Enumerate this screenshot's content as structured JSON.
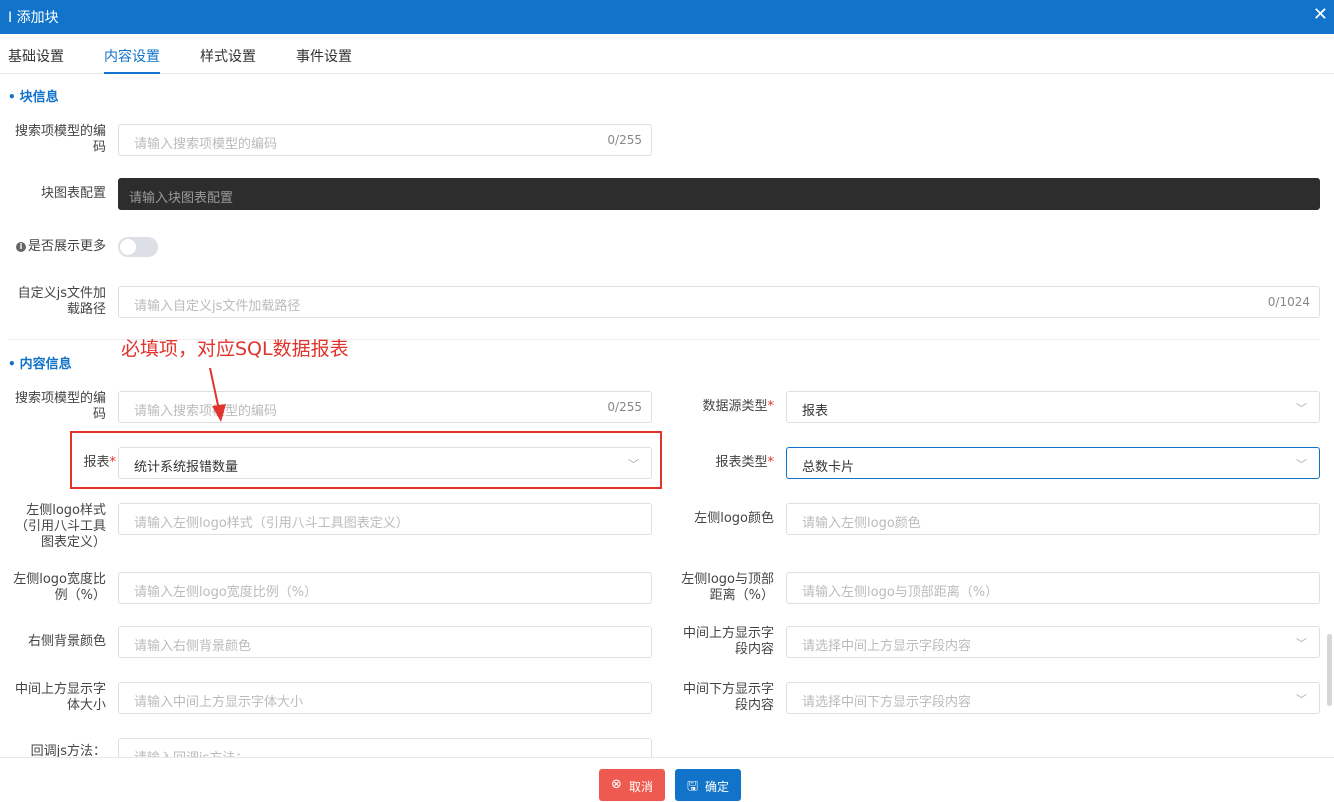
{
  "dialog": {
    "title": "I 添加块",
    "close_icon": "close-icon"
  },
  "tabs": [
    {
      "label": "基础设置"
    },
    {
      "label": "内容设置",
      "active": true
    },
    {
      "label": "样式设置"
    },
    {
      "label": "事件设置"
    }
  ],
  "block_info": {
    "title": "块信息",
    "search_model_code": {
      "label": "搜索项模型的编码",
      "placeholder": "请输入搜索项模型的编码",
      "count": "0/255"
    },
    "chart_config": {
      "label": "块图表配置",
      "placeholder": "请输入块图表配置"
    },
    "show_more": {
      "label": "是否展示更多",
      "value": false
    },
    "custom_js": {
      "label": "自定义js文件加载路径",
      "placeholder": "请输入自定义js文件加载路径",
      "count": "0/1024"
    }
  },
  "content_info": {
    "title": "内容信息",
    "search_model_code": {
      "label": "搜索项模型的编码",
      "placeholder": "请输入搜索项模型的编码",
      "count": "0/255"
    },
    "datasource_type": {
      "label": "数据源类型",
      "value": "报表"
    },
    "report": {
      "label": "报表",
      "value": "统计系统报错数量"
    },
    "report_type": {
      "label": "报表类型",
      "value": "总数卡片"
    },
    "left_logo_style": {
      "label": "左侧logo样式（引用八斗工具图表定义）",
      "placeholder": "请输入左侧logo样式（引用八斗工具图表定义）"
    },
    "left_logo_color": {
      "label": "左侧logo颜色",
      "placeholder": "请输入左侧logo颜色"
    },
    "left_logo_width": {
      "label": "左侧logo宽度比例（%）",
      "placeholder": "请输入左侧logo宽度比例（%）"
    },
    "left_logo_top": {
      "label": "左侧logo与顶部距离（%）",
      "placeholder": "请输入左侧logo与顶部距离（%）"
    },
    "right_bg_color": {
      "label": "右侧背景颜色",
      "placeholder": "请输入右侧背景颜色"
    },
    "mid_top_field": {
      "label": "中间上方显示字段内容",
      "placeholder": "请选择中间上方显示字段内容"
    },
    "mid_top_font": {
      "label": "中间上方显示字体大小",
      "placeholder": "请输入中间上方显示字体大小"
    },
    "mid_bottom_field": {
      "label": "中间下方显示字段内容",
      "placeholder": "请选择中间下方显示字段内容"
    },
    "callback_js": {
      "label": "回调js方法：",
      "placeholder": "请输入回调js方法："
    }
  },
  "annotation": {
    "text": "必填项，对应SQL数据报表"
  },
  "footer": {
    "cancel_label": "取消",
    "confirm_label": "确定"
  },
  "colors": {
    "primary": "#1173c9",
    "danger": "#ef5a50",
    "annotation": "#e0342c"
  }
}
